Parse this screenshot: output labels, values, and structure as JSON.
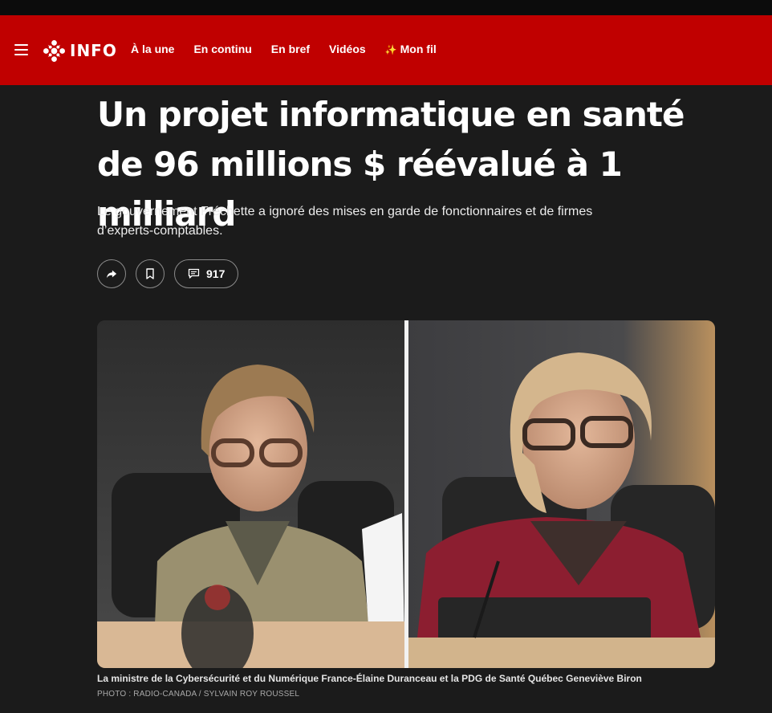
{
  "nav": {
    "brand": "INFO",
    "links": [
      "À la une",
      "En continu",
      "En bref",
      "Vidéos",
      "Mon fil"
    ],
    "icons": {
      "menu": "hamburger-icon",
      "logo": "radio-canada-gem-icon",
      "mon_fil": "sparkle-icon"
    }
  },
  "article": {
    "headline": "Un projet informatique en santé de 96 millions $ réévalué à 1 milliard",
    "subtitle": "Le gouvernement Fréchette a ignoré des mises en garde de fonctionnaires et de firmes d’experts-comptables.",
    "comments_count": "917",
    "photo_caption": "La ministre de la Cybersécurité et du Numérique France-Élaine Duranceau et la PDG de Santé Québec Geneviève Biron",
    "photo_credit": "PHOTO : RADIO-CANADA / SYLVAIN ROY ROUSSEL"
  },
  "colors": {
    "brand_red": "#c00000",
    "background": "#1b1b1b"
  }
}
